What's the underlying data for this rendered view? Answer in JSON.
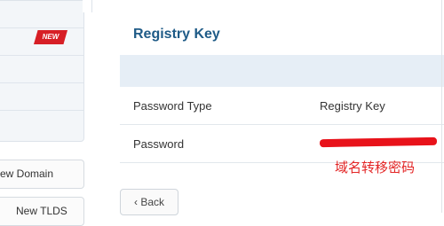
{
  "sidebar": {
    "new_badge": "NEW",
    "new_domain_label": "ew Domain",
    "new_tlds_label": "New TLDS"
  },
  "main": {
    "title": "Registry Key",
    "rows": [
      {
        "label": "Password Type",
        "value": "Registry Key"
      },
      {
        "label": "Password",
        "value": ""
      }
    ],
    "annotation": "域名转移密码",
    "back_label": "‹ Back"
  },
  "colors": {
    "title": "#1f5b87",
    "header_band": "#e6eef6",
    "badge": "#d71f26",
    "annotation": "#e32525"
  }
}
